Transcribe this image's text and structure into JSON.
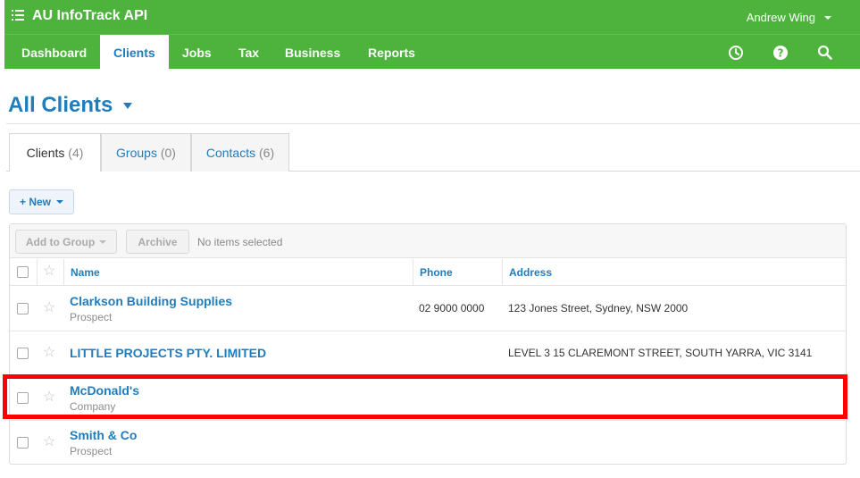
{
  "app": {
    "title": "AU InfoTrack API"
  },
  "user": {
    "name": "Andrew Wing"
  },
  "nav": {
    "items": [
      {
        "label": "Dashboard"
      },
      {
        "label": "Clients"
      },
      {
        "label": "Jobs"
      },
      {
        "label": "Tax"
      },
      {
        "label": "Business"
      },
      {
        "label": "Reports"
      }
    ],
    "icons": [
      "clock-icon",
      "help-icon",
      "search-icon"
    ]
  },
  "page": {
    "title": "All Clients"
  },
  "tabs": [
    {
      "label": "Clients",
      "count": "(4)"
    },
    {
      "label": "Groups",
      "count": "(0)"
    },
    {
      "label": "Contacts",
      "count": "(6)"
    }
  ],
  "actions": {
    "new_label": "+ New"
  },
  "toolbar": {
    "add_to_group": "Add to Group",
    "archive": "Archive",
    "status": "No items selected"
  },
  "table": {
    "columns": [
      "Name",
      "Phone",
      "Address"
    ],
    "rows": [
      {
        "name": "Clarkson Building Supplies",
        "type": "Prospect",
        "phone": "02 9000 0000",
        "address": "123 Jones Street, Sydney, NSW 2000"
      },
      {
        "name": "LITTLE PROJECTS PTY. LIMITED",
        "type": "",
        "phone": "",
        "address": "LEVEL 3 15 CLAREMONT STREET, SOUTH YARRA, VIC 3141"
      },
      {
        "name": "McDonald's",
        "type": "Company",
        "phone": "",
        "address": ""
      },
      {
        "name": "Smith & Co",
        "type": "Prospect",
        "phone": "",
        "address": ""
      }
    ]
  },
  "colors": {
    "brand": "#4db33d",
    "link": "#1f7dbd",
    "highlight": "#ff0000"
  }
}
